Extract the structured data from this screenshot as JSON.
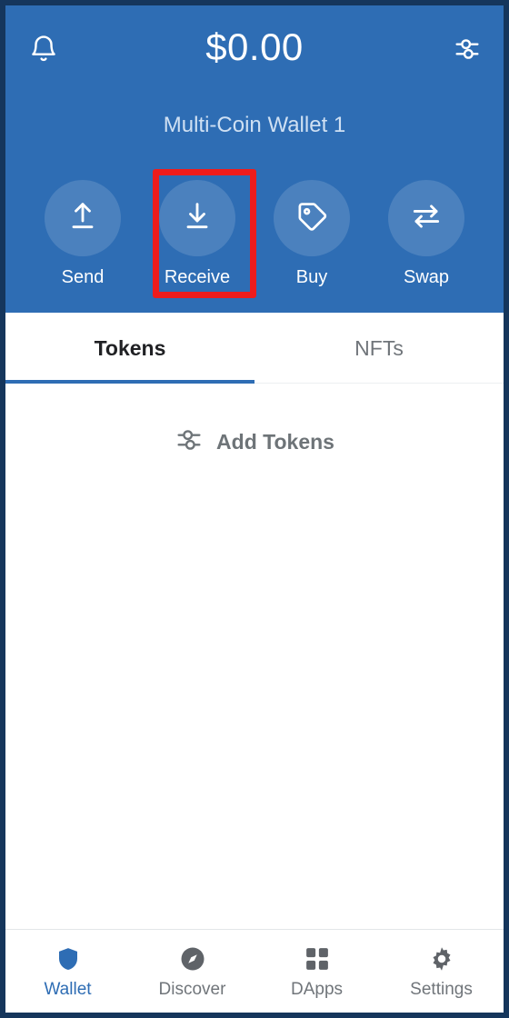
{
  "app": {
    "theme_color": "#2e6db4",
    "accent_color": "#2e6db4",
    "highlight_color": "#ee1c1c",
    "muted_color": "#70757a"
  },
  "header": {
    "notifications_icon": "bell-icon",
    "settings_icon": "sliders-icon",
    "balance": "$0.00",
    "wallet_name": "Multi-Coin Wallet 1",
    "actions": [
      {
        "label": "Send",
        "icon": "upload-arrow-icon"
      },
      {
        "label": "Receive",
        "icon": "download-arrow-icon",
        "highlighted": true
      },
      {
        "label": "Buy",
        "icon": "price-tag-icon"
      },
      {
        "label": "Swap",
        "icon": "swap-arrows-icon"
      }
    ]
  },
  "main": {
    "tabs": [
      {
        "label": "Tokens",
        "active": true
      },
      {
        "label": "NFTs",
        "active": false
      }
    ],
    "add_tokens": {
      "label": "Add Tokens",
      "icon": "sliders-icon"
    }
  },
  "bottom_nav": {
    "items": [
      {
        "label": "Wallet",
        "icon": "shield-icon",
        "active": true
      },
      {
        "label": "Discover",
        "icon": "compass-icon",
        "active": false
      },
      {
        "label": "DApps",
        "icon": "grid-icon",
        "active": false
      },
      {
        "label": "Settings",
        "icon": "gear-icon",
        "active": false
      }
    ]
  }
}
